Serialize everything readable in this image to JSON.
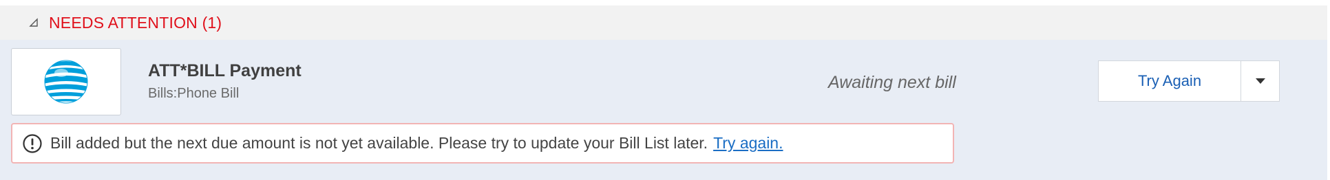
{
  "section": {
    "title": "NEEDS ATTENTION (1)",
    "collapse_icon": "collapse-triangle-icon"
  },
  "bill": {
    "logo_icon": "att-globe-logo",
    "name": "ATT*BILL Payment",
    "category": "Bills:Phone Bill",
    "status": "Awaiting next bill",
    "try_again_label": "Try Again",
    "dropdown_icon": "caret-down-icon"
  },
  "alert": {
    "icon": "exclamation-circle-icon",
    "message": "Bill added but the next due amount is not yet available. Please try to update your Bill List later.",
    "link_label": "Try again."
  },
  "colors": {
    "attention_red": "#e0101b",
    "link_blue": "#1a6dc4",
    "panel_bg": "#e8edf5",
    "att_blue": "#009fdb"
  }
}
